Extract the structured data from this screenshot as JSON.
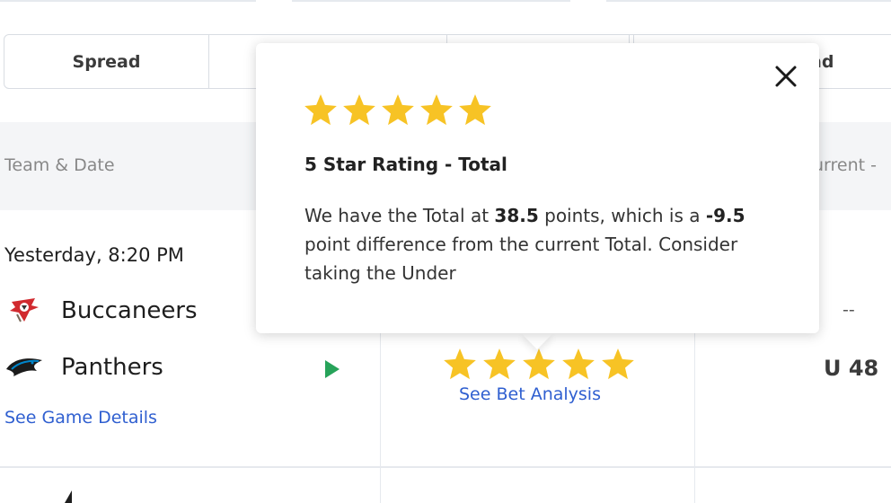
{
  "tabs": [
    {
      "label": "Spread"
    },
    {
      "label": ""
    },
    {
      "label": ""
    },
    {
      "label": ""
    },
    {
      "label": "ad"
    }
  ],
  "table_header": {
    "team_date": "Team & Date",
    "current": "urrent -"
  },
  "game": {
    "date": "Yesterday, 8:20 PM",
    "teams": [
      {
        "name": "Buccaneers",
        "logo_icon": "buccaneers-logo-icon"
      },
      {
        "name": "Panthers",
        "logo_icon": "panthers-logo-icon"
      }
    ],
    "details_link": "See Game Details",
    "analysis_link": "See Bet Analysis",
    "rating": 5,
    "current_top": "--",
    "current_value": "U 48"
  },
  "popup": {
    "rating": 5,
    "title": "5 Star Rating - Total",
    "body_part1": "We have the Total at ",
    "body_bold1": "38.5",
    "body_part2": " points, which is a ",
    "body_bold2": "-9.5",
    "body_part3": " point difference from the current Total. Consider taking the Under"
  },
  "colors": {
    "star": "#f7c325",
    "link": "#2f5fd0",
    "play": "#27a35a"
  }
}
